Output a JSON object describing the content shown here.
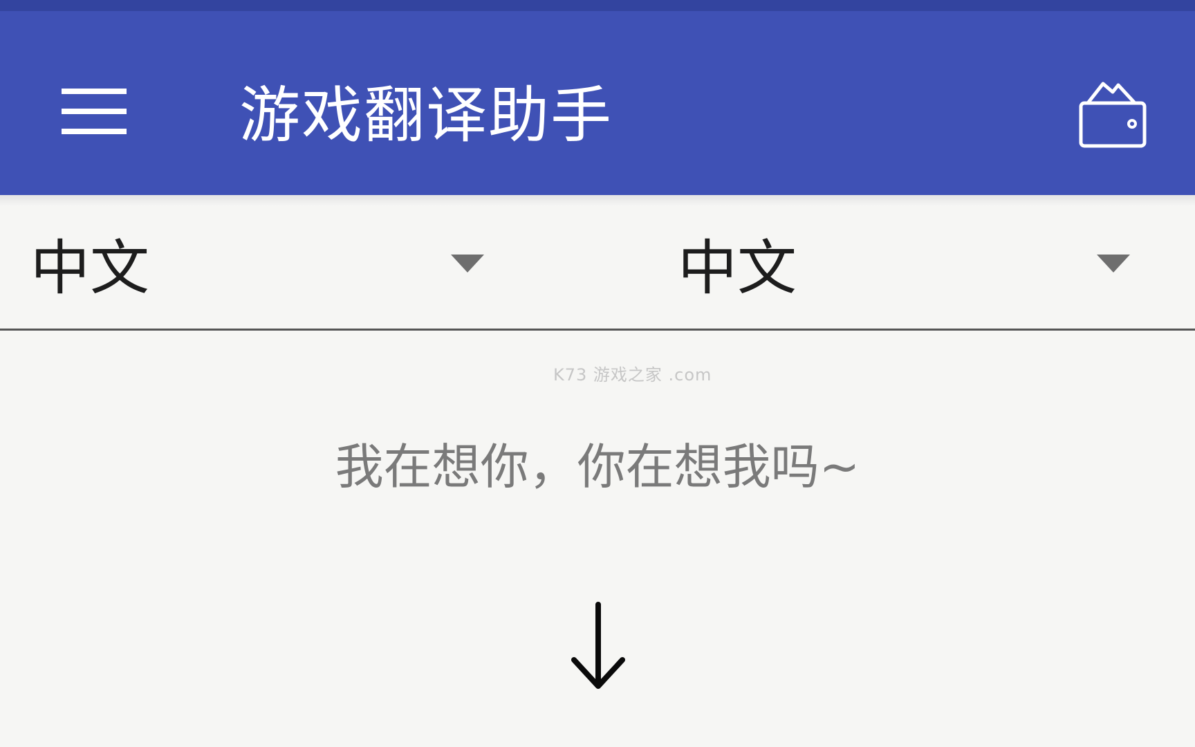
{
  "app_bar": {
    "title": "游戏翻译助手",
    "menu_icon": "hamburger-menu-icon",
    "wallet_icon": "wallet-icon",
    "colors": {
      "primary": "#3f51b5",
      "primary_dark": "#33449f"
    }
  },
  "language_selector": {
    "source_language": "中文",
    "target_language": "中文",
    "dropdown_icon": "triangle-down-icon"
  },
  "main": {
    "watermark": "K73 游戏之家 .com",
    "input_text": "我在想你，你在想我吗~",
    "translate_icon": "arrow-down-icon"
  }
}
